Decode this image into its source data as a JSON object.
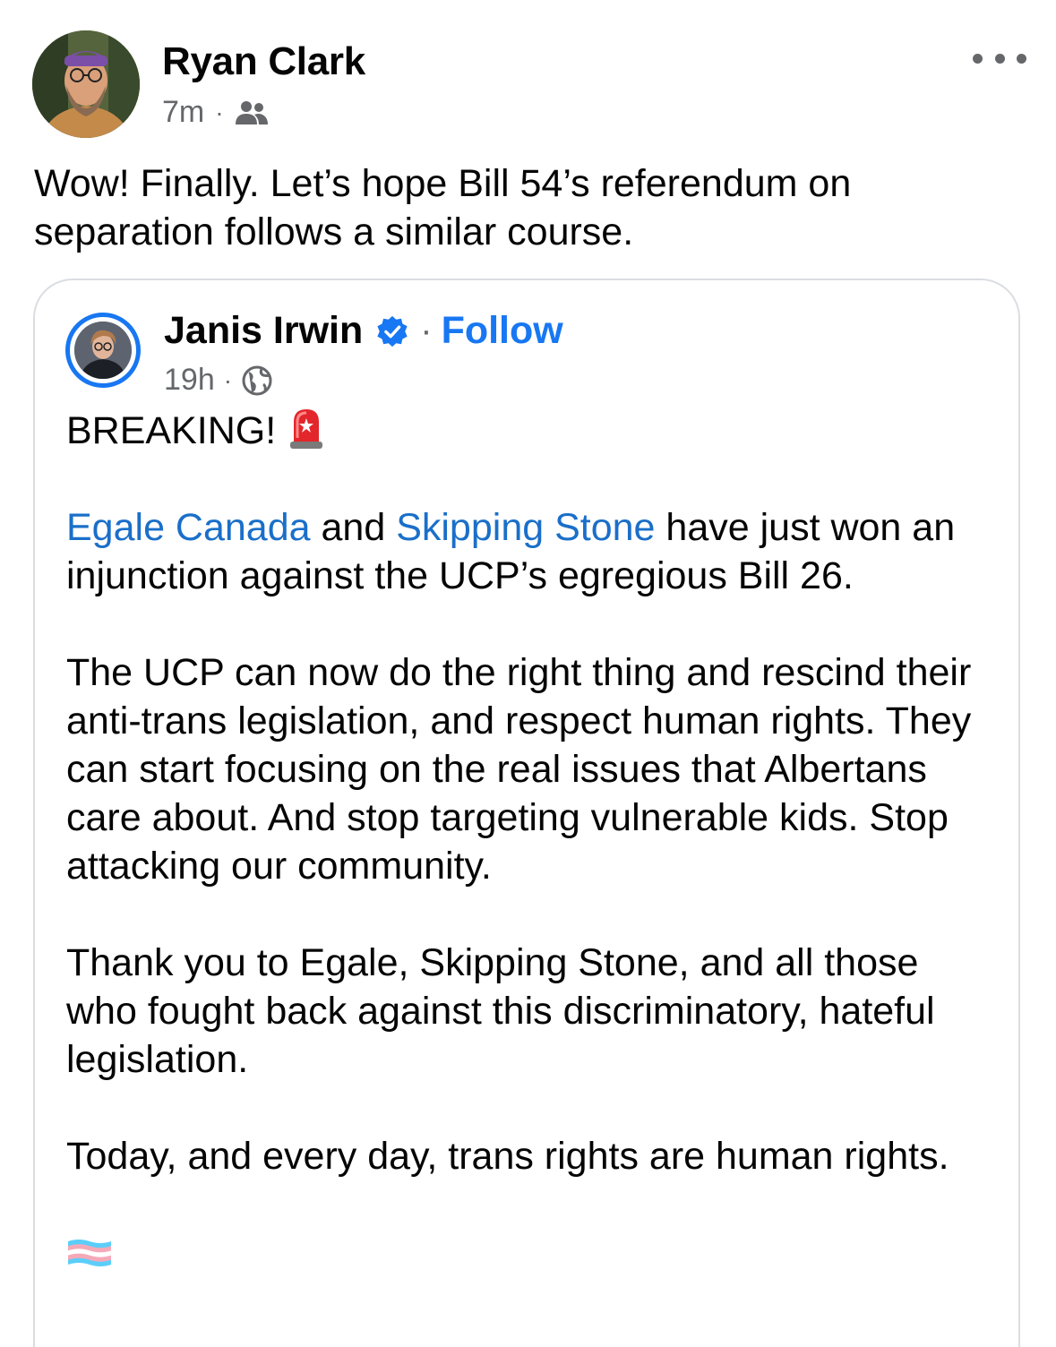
{
  "post": {
    "author": "Ryan Clark",
    "time": "7m",
    "separator": "·",
    "text": "Wow! Finally. Let’s hope Bill 54’s referendum on separation follows a similar course."
  },
  "shared": {
    "author": "Janis Irwin",
    "separator": "·",
    "follow_label": "Follow",
    "time": "19h",
    "breaking": "BREAKING!",
    "para1_link1": "Egale Canada",
    "para1_and": " and ",
    "para1_link2": "Skipping Stone",
    "para1_rest": " have just won an injunction against the UCP’s egregious Bill 26.",
    "para2": "The UCP can now do the right thing and rescind their anti-trans legislation, and respect human rights. They can start focusing on the real issues that Albertans care about. And stop targeting vulnerable kids. Stop attacking our community.",
    "para3": "Thank you to Egale, Skipping Stone, and all those who fought back against this discriminatory, hateful legislation.",
    "para4": "Today, and every day, trans rights are human rights."
  },
  "icons": {
    "audience_post": "friends-icon",
    "audience_shared": "globe-icon",
    "verified": "verified-badge-icon",
    "more": "more-options-icon",
    "siren": "siren-emoji-icon",
    "flag": "trans-flag-emoji-icon"
  },
  "colors": {
    "link": "#1a6fc9",
    "follow": "#1877f2",
    "meta": "#65676b",
    "border": "#dadde1"
  }
}
